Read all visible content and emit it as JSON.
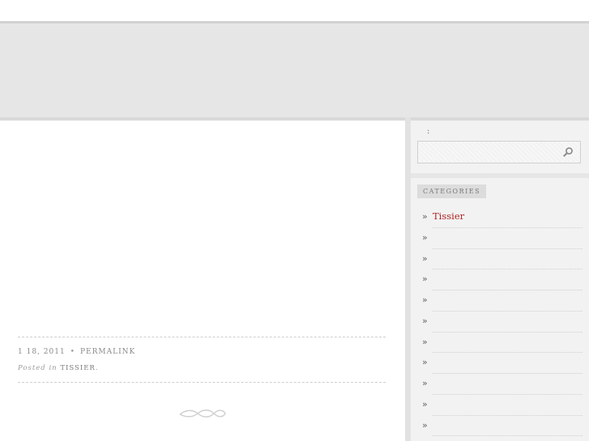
{
  "post": {
    "date": "1 18, 2011",
    "permalink": "PERMALINK",
    "posted_in": "Posted in",
    "category": "TISSIER"
  },
  "sidebar": {
    "search_label": ":",
    "search_placeholder": "",
    "categories_title": "CATEGORIES",
    "categories": [
      {
        "label": "Tissier"
      },
      {
        "label": ""
      },
      {
        "label": ""
      },
      {
        "label": ""
      },
      {
        "label": ""
      },
      {
        "label": ""
      },
      {
        "label": ""
      },
      {
        "label": ""
      },
      {
        "label": ""
      },
      {
        "label": ""
      },
      {
        "label": ""
      }
    ],
    "bullet": "»"
  },
  "colors": {
    "link": "#b22222",
    "banner": "#e6e6e6",
    "sidebar": "#f2f2f2"
  }
}
